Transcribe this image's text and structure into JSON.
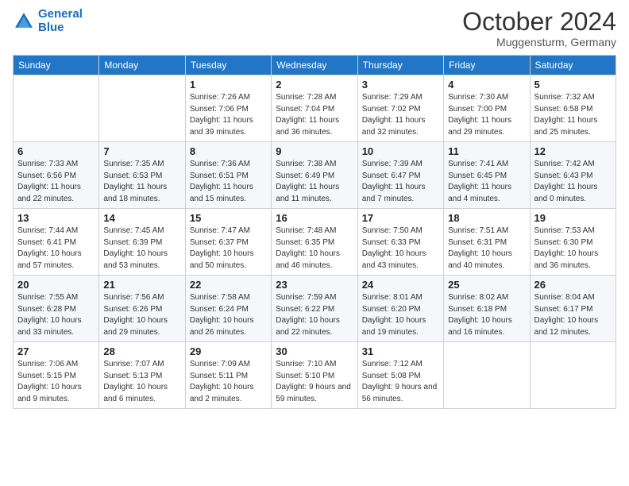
{
  "header": {
    "logo_line1": "General",
    "logo_line2": "Blue",
    "month": "October 2024",
    "location": "Muggensturm, Germany"
  },
  "weekdays": [
    "Sunday",
    "Monday",
    "Tuesday",
    "Wednesday",
    "Thursday",
    "Friday",
    "Saturday"
  ],
  "weeks": [
    [
      {
        "day": "",
        "sunrise": "",
        "sunset": "",
        "daylight": ""
      },
      {
        "day": "",
        "sunrise": "",
        "sunset": "",
        "daylight": ""
      },
      {
        "day": "1",
        "sunrise": "Sunrise: 7:26 AM",
        "sunset": "Sunset: 7:06 PM",
        "daylight": "Daylight: 11 hours and 39 minutes."
      },
      {
        "day": "2",
        "sunrise": "Sunrise: 7:28 AM",
        "sunset": "Sunset: 7:04 PM",
        "daylight": "Daylight: 11 hours and 36 minutes."
      },
      {
        "day": "3",
        "sunrise": "Sunrise: 7:29 AM",
        "sunset": "Sunset: 7:02 PM",
        "daylight": "Daylight: 11 hours and 32 minutes."
      },
      {
        "day": "4",
        "sunrise": "Sunrise: 7:30 AM",
        "sunset": "Sunset: 7:00 PM",
        "daylight": "Daylight: 11 hours and 29 minutes."
      },
      {
        "day": "5",
        "sunrise": "Sunrise: 7:32 AM",
        "sunset": "Sunset: 6:58 PM",
        "daylight": "Daylight: 11 hours and 25 minutes."
      }
    ],
    [
      {
        "day": "6",
        "sunrise": "Sunrise: 7:33 AM",
        "sunset": "Sunset: 6:56 PM",
        "daylight": "Daylight: 11 hours and 22 minutes."
      },
      {
        "day": "7",
        "sunrise": "Sunrise: 7:35 AM",
        "sunset": "Sunset: 6:53 PM",
        "daylight": "Daylight: 11 hours and 18 minutes."
      },
      {
        "day": "8",
        "sunrise": "Sunrise: 7:36 AM",
        "sunset": "Sunset: 6:51 PM",
        "daylight": "Daylight: 11 hours and 15 minutes."
      },
      {
        "day": "9",
        "sunrise": "Sunrise: 7:38 AM",
        "sunset": "Sunset: 6:49 PM",
        "daylight": "Daylight: 11 hours and 11 minutes."
      },
      {
        "day": "10",
        "sunrise": "Sunrise: 7:39 AM",
        "sunset": "Sunset: 6:47 PM",
        "daylight": "Daylight: 11 hours and 7 minutes."
      },
      {
        "day": "11",
        "sunrise": "Sunrise: 7:41 AM",
        "sunset": "Sunset: 6:45 PM",
        "daylight": "Daylight: 11 hours and 4 minutes."
      },
      {
        "day": "12",
        "sunrise": "Sunrise: 7:42 AM",
        "sunset": "Sunset: 6:43 PM",
        "daylight": "Daylight: 11 hours and 0 minutes."
      }
    ],
    [
      {
        "day": "13",
        "sunrise": "Sunrise: 7:44 AM",
        "sunset": "Sunset: 6:41 PM",
        "daylight": "Daylight: 10 hours and 57 minutes."
      },
      {
        "day": "14",
        "sunrise": "Sunrise: 7:45 AM",
        "sunset": "Sunset: 6:39 PM",
        "daylight": "Daylight: 10 hours and 53 minutes."
      },
      {
        "day": "15",
        "sunrise": "Sunrise: 7:47 AM",
        "sunset": "Sunset: 6:37 PM",
        "daylight": "Daylight: 10 hours and 50 minutes."
      },
      {
        "day": "16",
        "sunrise": "Sunrise: 7:48 AM",
        "sunset": "Sunset: 6:35 PM",
        "daylight": "Daylight: 10 hours and 46 minutes."
      },
      {
        "day": "17",
        "sunrise": "Sunrise: 7:50 AM",
        "sunset": "Sunset: 6:33 PM",
        "daylight": "Daylight: 10 hours and 43 minutes."
      },
      {
        "day": "18",
        "sunrise": "Sunrise: 7:51 AM",
        "sunset": "Sunset: 6:31 PM",
        "daylight": "Daylight: 10 hours and 40 minutes."
      },
      {
        "day": "19",
        "sunrise": "Sunrise: 7:53 AM",
        "sunset": "Sunset: 6:30 PM",
        "daylight": "Daylight: 10 hours and 36 minutes."
      }
    ],
    [
      {
        "day": "20",
        "sunrise": "Sunrise: 7:55 AM",
        "sunset": "Sunset: 6:28 PM",
        "daylight": "Daylight: 10 hours and 33 minutes."
      },
      {
        "day": "21",
        "sunrise": "Sunrise: 7:56 AM",
        "sunset": "Sunset: 6:26 PM",
        "daylight": "Daylight: 10 hours and 29 minutes."
      },
      {
        "day": "22",
        "sunrise": "Sunrise: 7:58 AM",
        "sunset": "Sunset: 6:24 PM",
        "daylight": "Daylight: 10 hours and 26 minutes."
      },
      {
        "day": "23",
        "sunrise": "Sunrise: 7:59 AM",
        "sunset": "Sunset: 6:22 PM",
        "daylight": "Daylight: 10 hours and 22 minutes."
      },
      {
        "day": "24",
        "sunrise": "Sunrise: 8:01 AM",
        "sunset": "Sunset: 6:20 PM",
        "daylight": "Daylight: 10 hours and 19 minutes."
      },
      {
        "day": "25",
        "sunrise": "Sunrise: 8:02 AM",
        "sunset": "Sunset: 6:18 PM",
        "daylight": "Daylight: 10 hours and 16 minutes."
      },
      {
        "day": "26",
        "sunrise": "Sunrise: 8:04 AM",
        "sunset": "Sunset: 6:17 PM",
        "daylight": "Daylight: 10 hours and 12 minutes."
      }
    ],
    [
      {
        "day": "27",
        "sunrise": "Sunrise: 7:06 AM",
        "sunset": "Sunset: 5:15 PM",
        "daylight": "Daylight: 10 hours and 9 minutes."
      },
      {
        "day": "28",
        "sunrise": "Sunrise: 7:07 AM",
        "sunset": "Sunset: 5:13 PM",
        "daylight": "Daylight: 10 hours and 6 minutes."
      },
      {
        "day": "29",
        "sunrise": "Sunrise: 7:09 AM",
        "sunset": "Sunset: 5:11 PM",
        "daylight": "Daylight: 10 hours and 2 minutes."
      },
      {
        "day": "30",
        "sunrise": "Sunrise: 7:10 AM",
        "sunset": "Sunset: 5:10 PM",
        "daylight": "Daylight: 9 hours and 59 minutes."
      },
      {
        "day": "31",
        "sunrise": "Sunrise: 7:12 AM",
        "sunset": "Sunset: 5:08 PM",
        "daylight": "Daylight: 9 hours and 56 minutes."
      },
      {
        "day": "",
        "sunrise": "",
        "sunset": "",
        "daylight": ""
      },
      {
        "day": "",
        "sunrise": "",
        "sunset": "",
        "daylight": ""
      }
    ]
  ]
}
